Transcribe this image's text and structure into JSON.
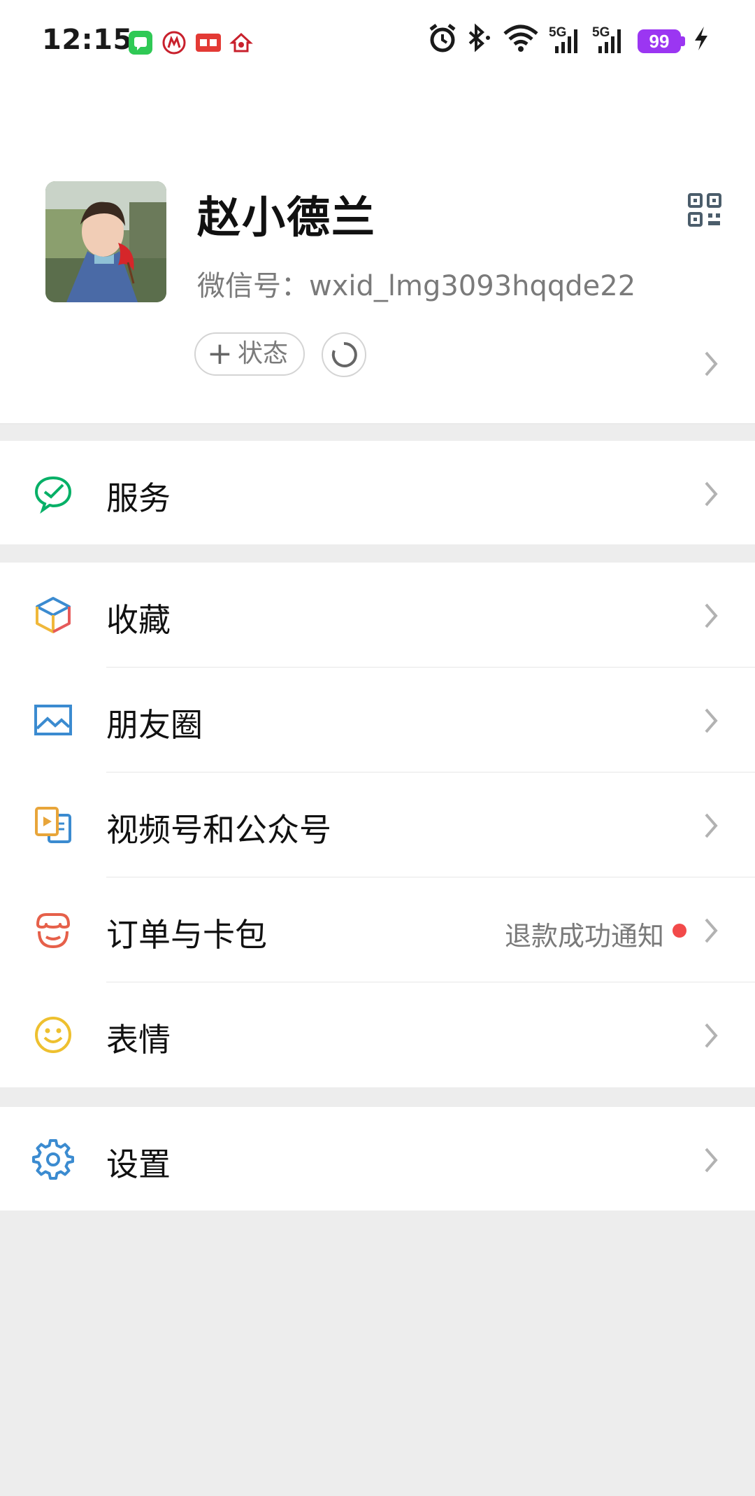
{
  "status_bar": {
    "time": "12:15",
    "battery": "99",
    "network1": "5G",
    "network2": "5G",
    "icons": [
      "messages-app-icon",
      "cmb-bank-icon",
      "toutiao-icon",
      "home-app-icon",
      "alarm-icon",
      "bluetooth-icon",
      "wifi-icon",
      "signal-icon",
      "charging-icon"
    ]
  },
  "profile": {
    "name": "赵小德兰",
    "wxid_label": "微信号：",
    "wxid_value": "wxid_lmg3093hqqde22",
    "status_button_label": "状态",
    "status_button_icon": "plus-icon"
  },
  "menu": {
    "services": {
      "label": "服务",
      "icon": "services-icon"
    },
    "favorites": {
      "label": "收藏",
      "icon": "favorites-cube-icon"
    },
    "moments": {
      "label": "朋友圈",
      "icon": "moments-photo-icon"
    },
    "channels": {
      "label": "视频号和公众号",
      "icon": "channels-icon"
    },
    "orders": {
      "label": "订单与卡包",
      "icon": "orders-wallet-icon",
      "note": "退款成功通知"
    },
    "stickers": {
      "label": "表情",
      "icon": "smiley-icon"
    },
    "settings": {
      "label": "设置",
      "icon": "gear-icon"
    }
  },
  "colors": {
    "background": "#ededed",
    "card": "#ffffff",
    "battery": "#9b36f2",
    "badge_dot": "#f24a4a",
    "wechat_green": "#07c160"
  }
}
